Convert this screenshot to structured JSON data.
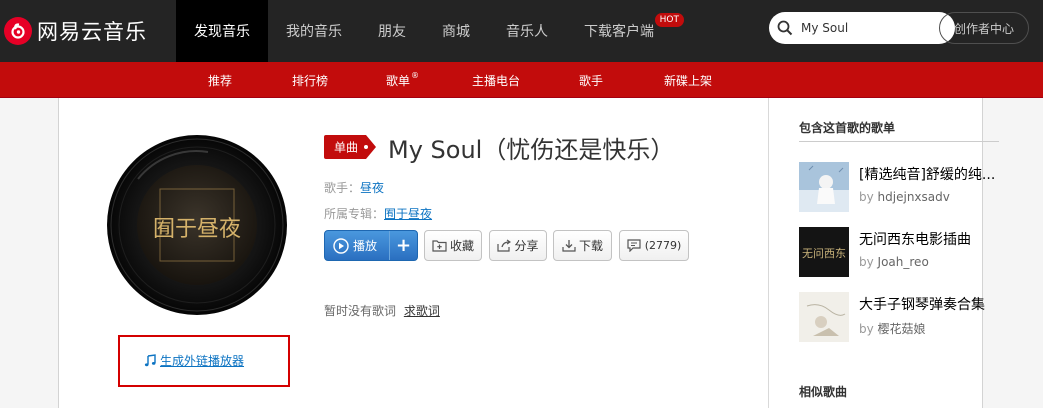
{
  "brand": {
    "name": "网易云音乐"
  },
  "nav": [
    {
      "label": "发现音乐",
      "active": true
    },
    {
      "label": "我的音乐"
    },
    {
      "label": "朋友"
    },
    {
      "label": "商城"
    },
    {
      "label": "音乐人"
    },
    {
      "label": "下载客户端",
      "badge": "HOT"
    }
  ],
  "search": {
    "value": "My Soul"
  },
  "creator_center": "创作者中心",
  "subnav": [
    {
      "label": "推荐"
    },
    {
      "label": "排行榜"
    },
    {
      "label": "歌单",
      "mark": "®"
    },
    {
      "label": "主播电台"
    },
    {
      "label": "歌手"
    },
    {
      "label": "新碟上架"
    }
  ],
  "song": {
    "tag": "单曲",
    "title": "My Soul（忧伤还是快乐）",
    "artist_label": "歌手：",
    "artist": "昼夜",
    "album_label": "所属专辑：",
    "album": "囿于昼夜",
    "cover_text": "囿于昼夜"
  },
  "actions": {
    "play": "播放",
    "plus": "+",
    "collect": "收藏",
    "share": "分享",
    "download": "下载",
    "comment_count": "(2779)"
  },
  "lyric": {
    "none": "暂时没有歌词",
    "request": "求歌词"
  },
  "external_player": "生成外链播放器",
  "sidebar": {
    "playlists_title": "包含这首歌的歌单",
    "playlists": [
      {
        "name": "[精选纯音]舒缓的纯...",
        "by_label": "by",
        "creator": "hdjejnxsadv"
      },
      {
        "name": "无问西东电影插曲",
        "by_label": "by",
        "creator": "Joah_reo",
        "cover_text": "无问西东"
      },
      {
        "name": "大手子钢琴弹奏合集",
        "by_label": "by",
        "creator": "樱花菇娘"
      }
    ],
    "similar_title": "相似歌曲"
  },
  "colors": {
    "brand_red": "#c20c0c",
    "link_blue": "#0c73c2",
    "topbar": "#242424"
  }
}
